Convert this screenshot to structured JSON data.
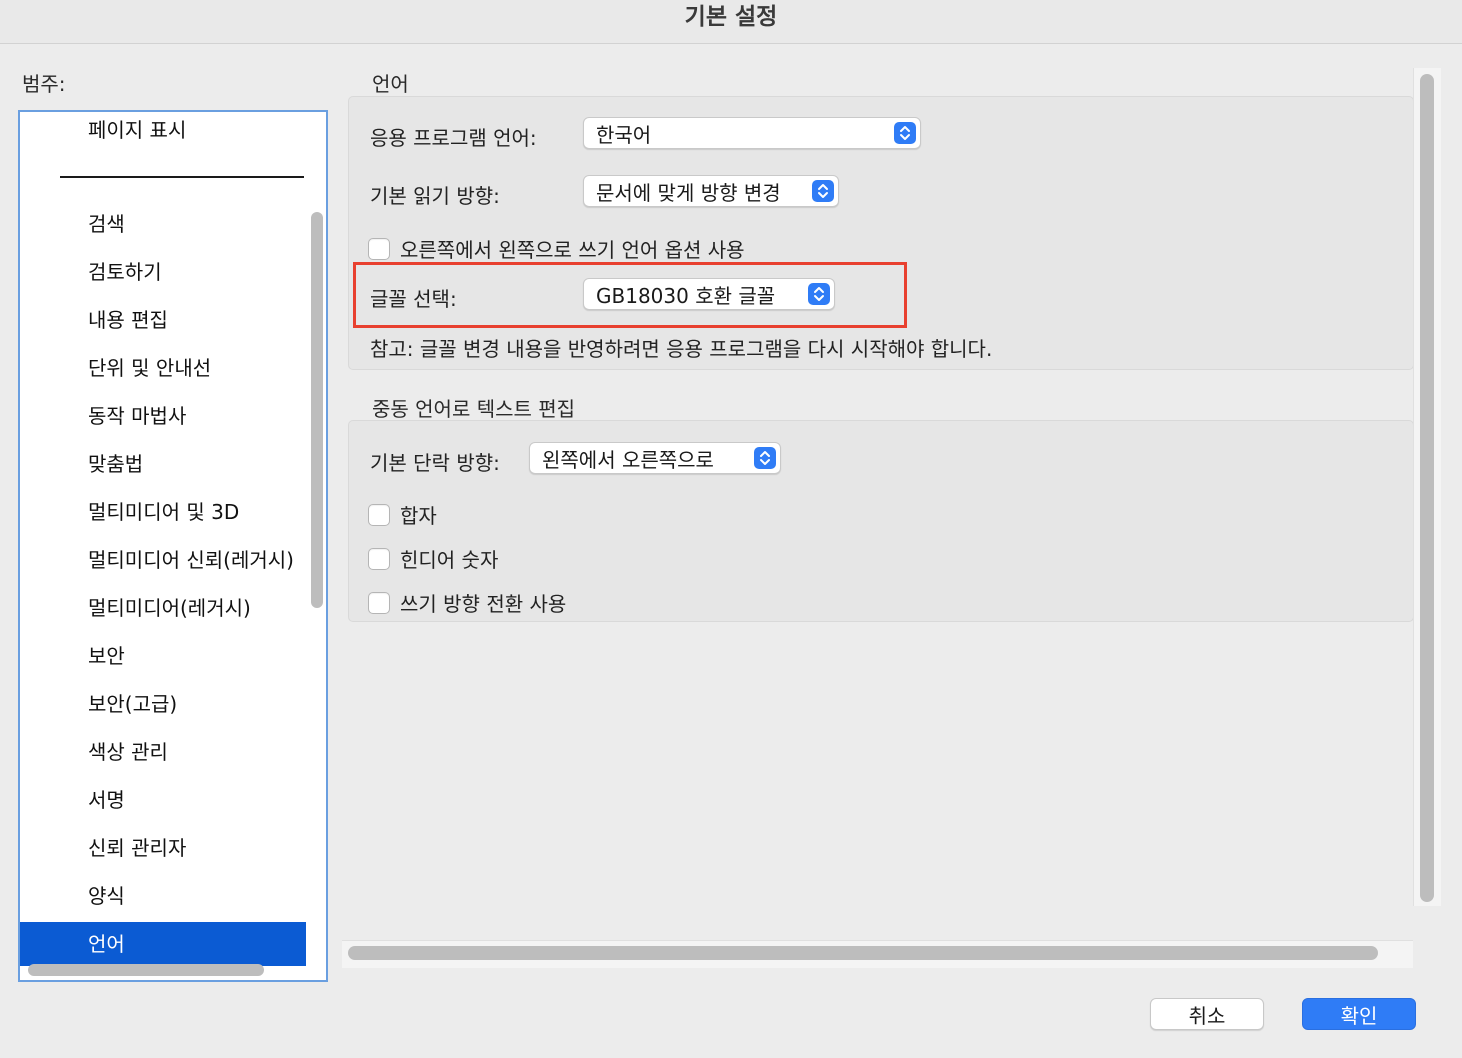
{
  "window": {
    "title": "기본 설정"
  },
  "categories": {
    "label": "범주:",
    "items": [
      "페이지 표시",
      "검색",
      "검토하기",
      "내용 편집",
      "단위 및 안내선",
      "동작 마법사",
      "맞춤법",
      "멀티미디어 및 3D",
      "멀티미디어 신뢰(레거시)",
      "멀티미디어(레거시)",
      "보안",
      "보안(고급)",
      "색상 관리",
      "서명",
      "신뢰 관리자",
      "양식",
      "언어"
    ],
    "selected": "언어"
  },
  "language_section": {
    "title": "언어",
    "app_language": {
      "label": "응용 프로그램 언어:",
      "value": "한국어"
    },
    "reading_direction": {
      "label": "기본 읽기 방향:",
      "value": "문서에 맞게 방향 변경"
    },
    "rtl_option": {
      "label": "오른쪽에서 왼쪽으로 쓰기 언어 옵션 사용",
      "checked": false
    },
    "font_select": {
      "label": "글꼴 선택:",
      "value": "GB18030 호환 글꼴"
    },
    "note": "참고: 글꼴 변경 내용을 반영하려면 응용 프로그램을 다시 시작해야 합니다."
  },
  "mideast_section": {
    "title": "중동 언어로 텍스트 편집",
    "paragraph_direction": {
      "label": "기본 단락 방향:",
      "value": "왼쪽에서 오른쪽으로"
    },
    "ligatures": {
      "label": "합자",
      "checked": false
    },
    "hindi_digits": {
      "label": "힌디어 숫자",
      "checked": false
    },
    "direction_toggle": {
      "label": "쓰기 방향 전환 사용",
      "checked": false
    }
  },
  "buttons": {
    "cancel": "취소",
    "ok": "확인"
  },
  "colors": {
    "accent": "#2f7cf6",
    "selected": "#0b5bd3",
    "highlight": "#e8402f"
  }
}
